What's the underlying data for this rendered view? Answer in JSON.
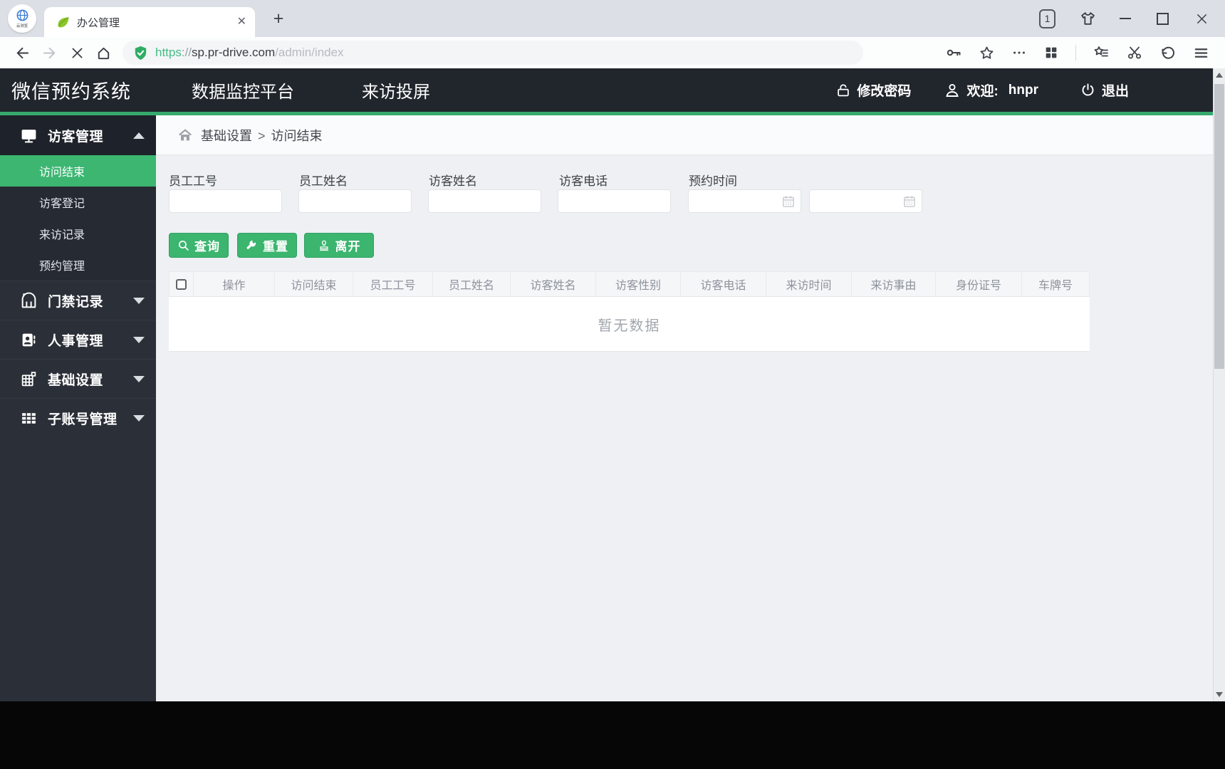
{
  "browser": {
    "tab_title": "办公管理",
    "tab_count": "1",
    "url": {
      "scheme": "https",
      "sep": "://",
      "host": "sp.pr-drive.com",
      "path": "/admin/index"
    }
  },
  "header": {
    "brand": "微信预约系统",
    "nav_monitor": "数据监控平台",
    "nav_cast": "来访投屏",
    "change_password": "修改密码",
    "welcome": "欢迎:",
    "username": "hnpr",
    "logout": "退出"
  },
  "sidebar": {
    "visitor_mgmt": "访客管理",
    "sub_visit_end": "访问结束",
    "sub_register": "访客登记",
    "sub_records": "来访记录",
    "sub_reservation": "预约管理",
    "door_records": "门禁记录",
    "hr_mgmt": "人事管理",
    "basic_settings": "基础设置",
    "subaccount_mgmt": "子账号管理"
  },
  "breadcrumb": {
    "parent": "基础设置",
    "sep": ">",
    "current": "访问结束"
  },
  "filters": {
    "emp_id": "员工工号",
    "emp_name": "员工姓名",
    "visitor_name": "访客姓名",
    "visitor_phone": "访客电话",
    "appoint_time": "预约时间"
  },
  "actions": {
    "query": "查询",
    "reset": "重置",
    "leave": "离开"
  },
  "table": {
    "columns": [
      "操作",
      "访问结束",
      "员工工号",
      "员工姓名",
      "访客姓名",
      "访客性别",
      "访客电话",
      "来访时间",
      "来访事由",
      "身份证号",
      "车牌号"
    ],
    "empty": "暂无数据"
  },
  "colors": {
    "accent_green": "#3cb671",
    "header_dark": "#21262d",
    "sidebar_dark": "#2b2f38"
  }
}
